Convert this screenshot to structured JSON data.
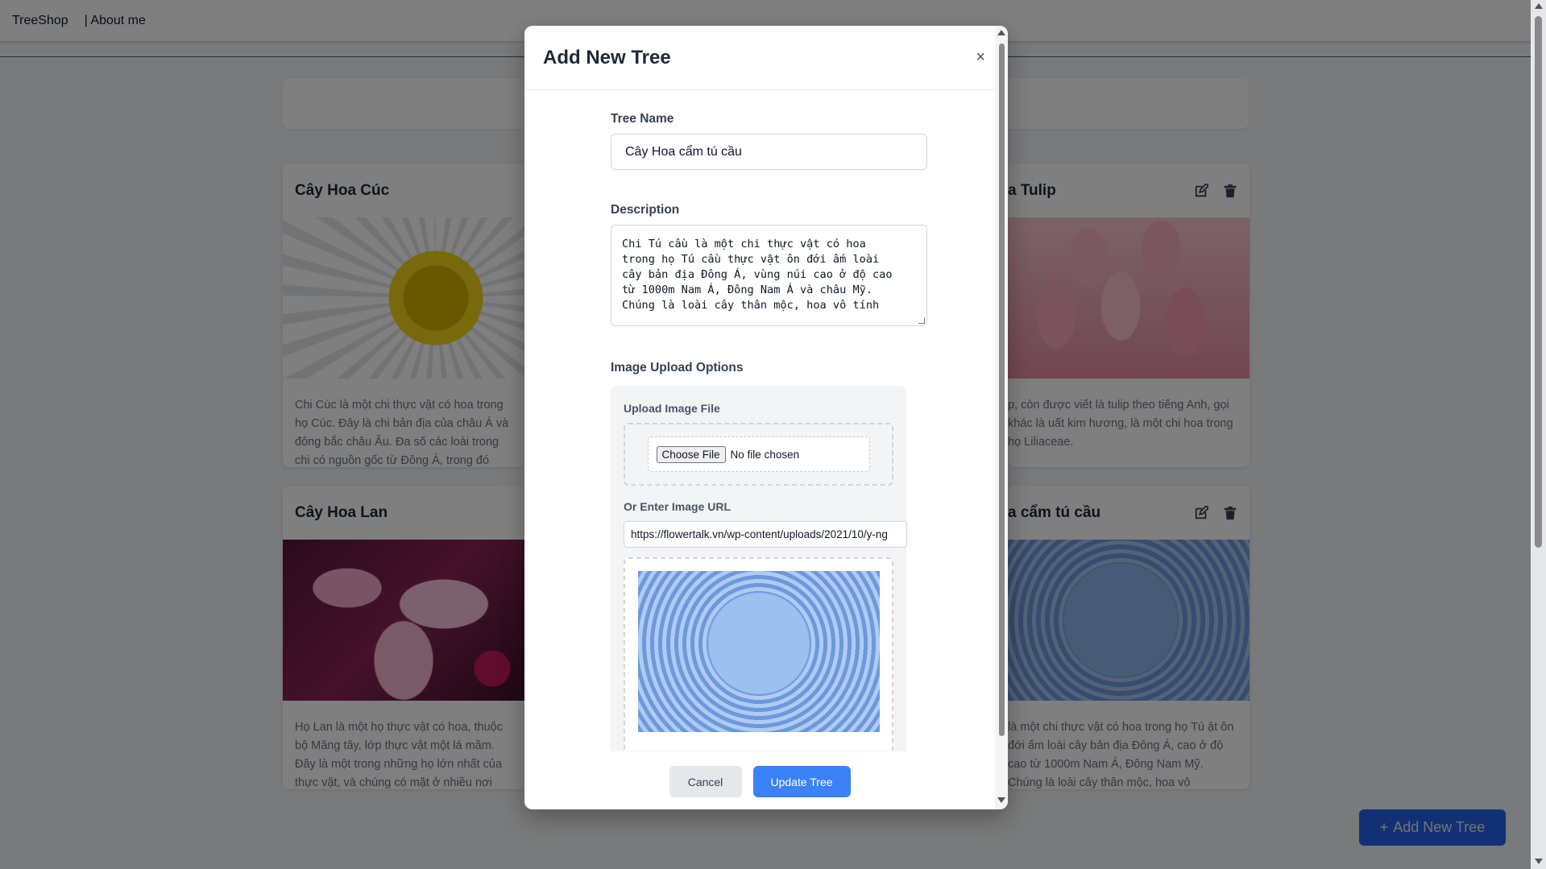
{
  "nav": {
    "brand": "TreeShop",
    "about": "| About me"
  },
  "cards": [
    {
      "title": "Cây Hoa Cúc",
      "desc": "Chi Cúc là một chi thực vật có hoa trong họ Cúc. Đây là chi bản địa của châu Á và đông bắc châu Âu. Đa số các loài trong chi có nguồn gốc từ Đông Á, trong đó trung tâm đa dạng là Trung Quốc."
    },
    {
      "title": "a Tulip",
      "desc": "p, còn được viết là tulip theo tiếng Anh, gọi khác là uất kim hương, là một chi hoa trong họ Liliaceae."
    },
    {
      "title": "Cây Hoa Lan",
      "desc": "Họ Lan là một họ thực vật có hoa, thuộc bộ Măng tây, lớp thực vật một lá mầm. Đây là một trong những họ lớn nhất của thực vật, và chúng có mặt ở nhiều nơi trên thế giới. Vườn thực vật hoàng gia"
    },
    {
      "title": "a cẩm tú cầu",
      "desc": "là một chi thực vật có hoa trong họ Tú ật ôn đới ấm loài cây bản địa Đông Á, cao ở độ cao từ 1000m Nam Á, Đông Nam Mỹ. Chúng là loài cây thân mộc, hoa vô"
    }
  ],
  "fab": {
    "label": "Add New Tree",
    "plus": "+"
  },
  "modal": {
    "title": "Add New Tree",
    "close": "×",
    "name_label": "Tree Name",
    "name_value": "Cây Hoa cẩm tú cầu",
    "desc_label": "Description",
    "desc_value": "Chi Tú cầu là một chi thực vật có hoa\ntrong họ Tú cầu thực vật ôn đới ấm loài\ncây bản địa Đông Á, vùng núi cao ở độ cao\ntừ 1000m Nam Á, Đông Nam Á và châu Mỹ.\nChúng là loài cây thân mộc, hoa vô tính",
    "upload_options_label": "Image Upload Options",
    "upload_file_label": "Upload Image File",
    "choose_file": "Choose File",
    "no_file": "No file chosen",
    "url_label": "Or Enter Image URL",
    "url_value": "https://flowertalk.vn/wp-content/uploads/2021/10/y-ng",
    "cancel": "Cancel",
    "update": "Update Tree"
  }
}
